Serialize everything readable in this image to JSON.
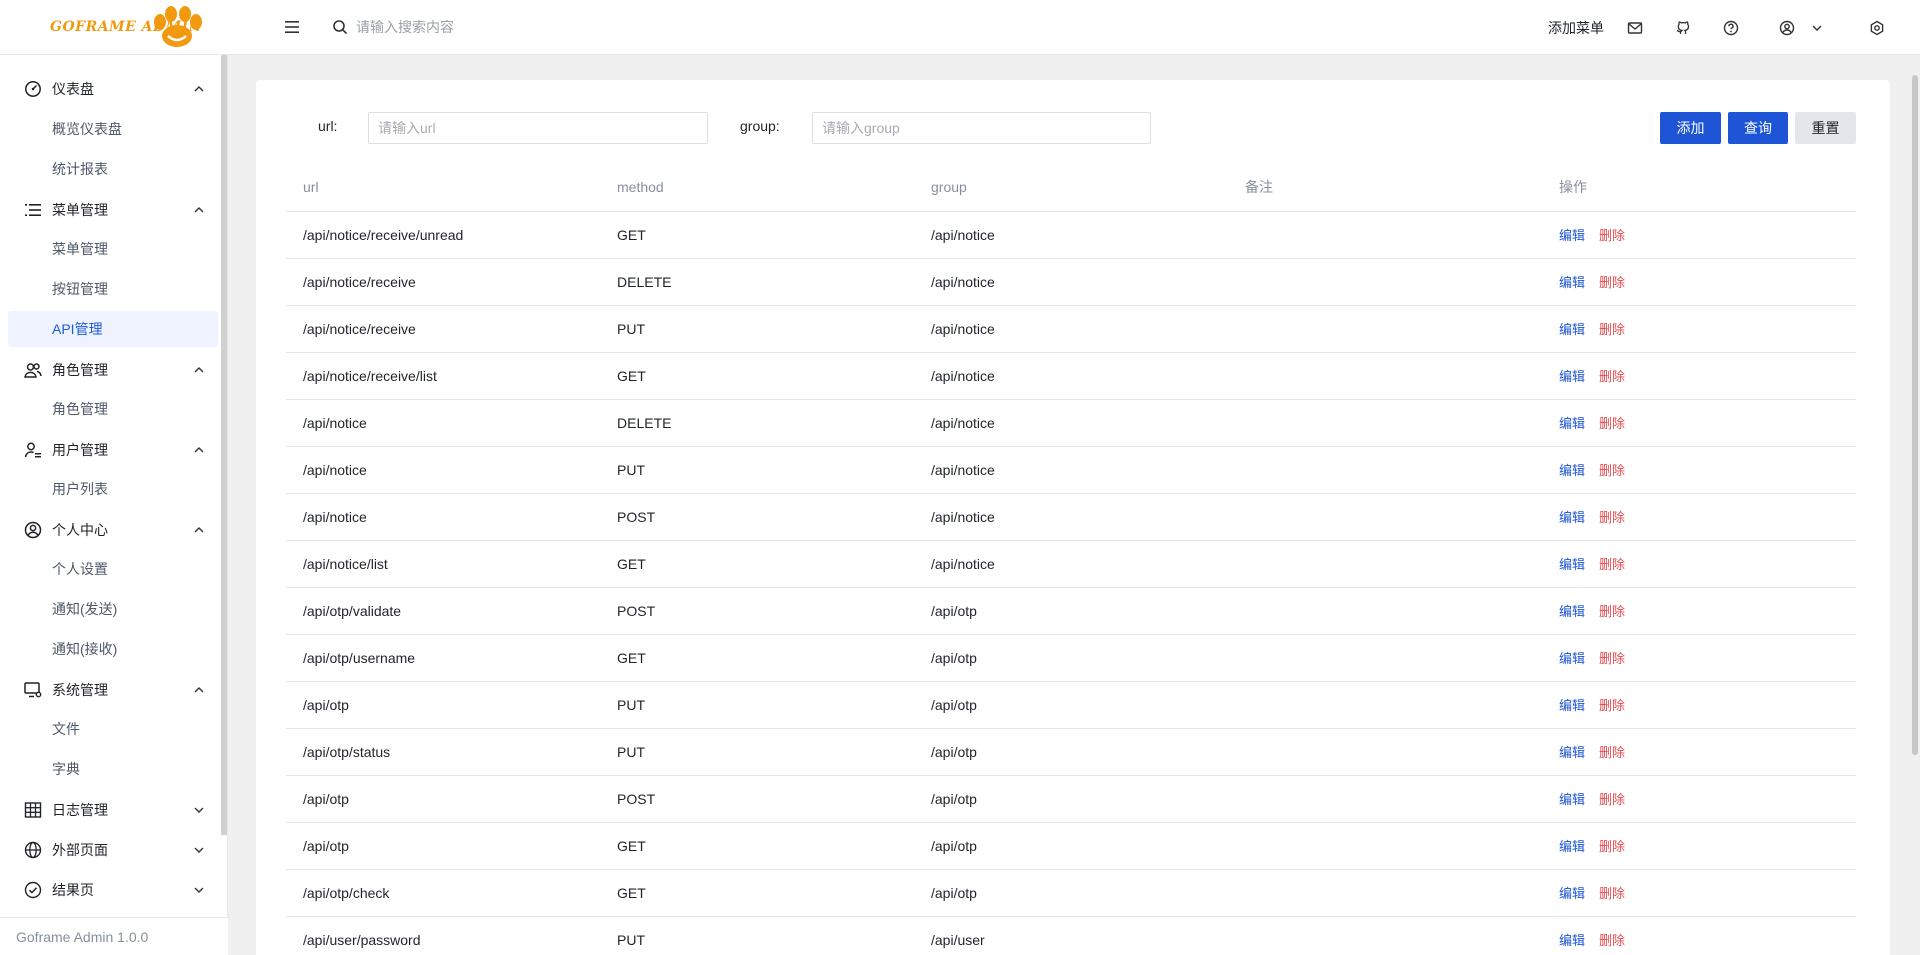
{
  "header": {
    "logo_text": "GOFRAME ADMIN",
    "search_placeholder": "请输入搜索内容",
    "add_menu_label": "添加菜单"
  },
  "sidebar": {
    "groups": [
      {
        "label": "仪表盘",
        "icon": "gauge-icon",
        "expanded": true,
        "items": [
          "概览仪表盘",
          "统计报表"
        ]
      },
      {
        "label": "菜单管理",
        "icon": "menu-list-icon",
        "expanded": true,
        "items": [
          "菜单管理",
          "按钮管理",
          "API管理"
        ]
      },
      {
        "label": "角色管理",
        "icon": "users-icon",
        "expanded": true,
        "items": [
          "角色管理"
        ]
      },
      {
        "label": "用户管理",
        "icon": "user-gear-icon",
        "expanded": true,
        "items": [
          "用户列表"
        ]
      },
      {
        "label": "个人中心",
        "icon": "user-circle-icon",
        "expanded": true,
        "items": [
          "个人设置",
          "通知(发送)",
          "通知(接收)"
        ]
      },
      {
        "label": "系统管理",
        "icon": "monitor-gear-icon",
        "expanded": true,
        "items": [
          "文件",
          "字典"
        ]
      },
      {
        "label": "日志管理",
        "icon": "table-icon",
        "expanded": false,
        "items": []
      },
      {
        "label": "外部页面",
        "icon": "globe-icon",
        "expanded": false,
        "items": []
      },
      {
        "label": "结果页",
        "icon": "check-circle-icon",
        "expanded": false,
        "items": []
      }
    ],
    "active_item": "API管理",
    "footer": "Goframe Admin 1.0.0"
  },
  "filters": {
    "url_label": "url:",
    "url_placeholder": "请输入url",
    "group_label": "group:",
    "group_placeholder": "请输入group"
  },
  "buttons": {
    "add": "添加",
    "query": "查询",
    "reset": "重置"
  },
  "table": {
    "columns": [
      "url",
      "method",
      "group",
      "备注",
      "操作"
    ],
    "edit_label": "编辑",
    "delete_label": "删除",
    "rows": [
      {
        "url": "/api/notice/receive/unread",
        "method": "GET",
        "group": "/api/notice",
        "note": ""
      },
      {
        "url": "/api/notice/receive",
        "method": "DELETE",
        "group": "/api/notice",
        "note": ""
      },
      {
        "url": "/api/notice/receive",
        "method": "PUT",
        "group": "/api/notice",
        "note": ""
      },
      {
        "url": "/api/notice/receive/list",
        "method": "GET",
        "group": "/api/notice",
        "note": ""
      },
      {
        "url": "/api/notice",
        "method": "DELETE",
        "group": "/api/notice",
        "note": ""
      },
      {
        "url": "/api/notice",
        "method": "PUT",
        "group": "/api/notice",
        "note": ""
      },
      {
        "url": "/api/notice",
        "method": "POST",
        "group": "/api/notice",
        "note": ""
      },
      {
        "url": "/api/notice/list",
        "method": "GET",
        "group": "/api/notice",
        "note": ""
      },
      {
        "url": "/api/otp/validate",
        "method": "POST",
        "group": "/api/otp",
        "note": ""
      },
      {
        "url": "/api/otp/username",
        "method": "GET",
        "group": "/api/otp",
        "note": ""
      },
      {
        "url": "/api/otp",
        "method": "PUT",
        "group": "/api/otp",
        "note": ""
      },
      {
        "url": "/api/otp/status",
        "method": "PUT",
        "group": "/api/otp",
        "note": ""
      },
      {
        "url": "/api/otp",
        "method": "POST",
        "group": "/api/otp",
        "note": ""
      },
      {
        "url": "/api/otp",
        "method": "GET",
        "group": "/api/otp",
        "note": ""
      },
      {
        "url": "/api/otp/check",
        "method": "GET",
        "group": "/api/otp",
        "note": ""
      },
      {
        "url": "/api/user/password",
        "method": "PUT",
        "group": "/api/user",
        "note": ""
      }
    ]
  },
  "colors": {
    "primary": "#1d55d6",
    "danger": "#e5484d",
    "logo": "#f29a0f",
    "active_bg": "#eef3ff"
  }
}
